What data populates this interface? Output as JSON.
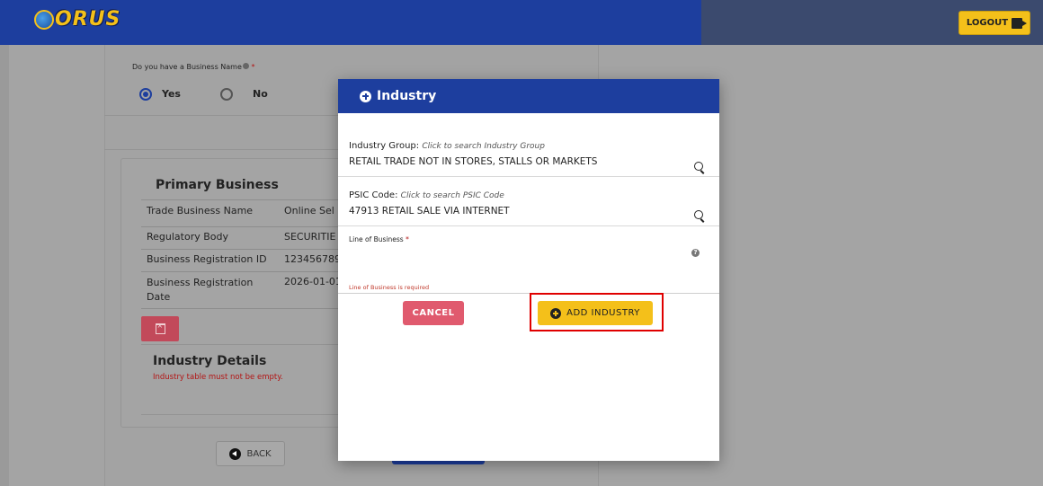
{
  "header": {
    "logo_text": "ORUS",
    "logout_label": "LOGOUT"
  },
  "form": {
    "business_name_question": "Do you have a Business Name",
    "required_mark": "*",
    "radio_yes": "Yes",
    "radio_no": "No",
    "selected": "Yes"
  },
  "primary_business": {
    "title": "Primary Business",
    "rows": [
      {
        "key": "Trade Business Name",
        "value": "Online Sel"
      },
      {
        "key": "Regulatory Body",
        "value": "SECURITIE"
      },
      {
        "key": "Business Registration ID",
        "value": "123456789"
      },
      {
        "key": "Business Registration Date",
        "value": "2026-01-01"
      }
    ]
  },
  "industry_details": {
    "title": "Industry Details",
    "error": "Industry table must not be empty."
  },
  "nav": {
    "back_label": "BACK"
  },
  "modal": {
    "title": "Industry",
    "industry_group_label": "Industry Group:",
    "industry_group_hint": "Click to search Industry Group",
    "industry_group_value": "RETAIL TRADE NOT IN STORES, STALLS OR MARKETS",
    "psic_label": "PSIC Code:",
    "psic_hint": "Click to search PSIC Code",
    "psic_value": "47913 RETAIL SALE VIA INTERNET",
    "lob_label": "Line of Business",
    "lob_required": "*",
    "lob_error": "Line of Business is required",
    "cancel_label": "CANCEL",
    "add_label": "ADD INDUSTRY"
  },
  "colors": {
    "navbar": "#1d3e9e",
    "accent": "#f4c01a",
    "danger": "#e05a6e",
    "highlight": "#e00000"
  }
}
